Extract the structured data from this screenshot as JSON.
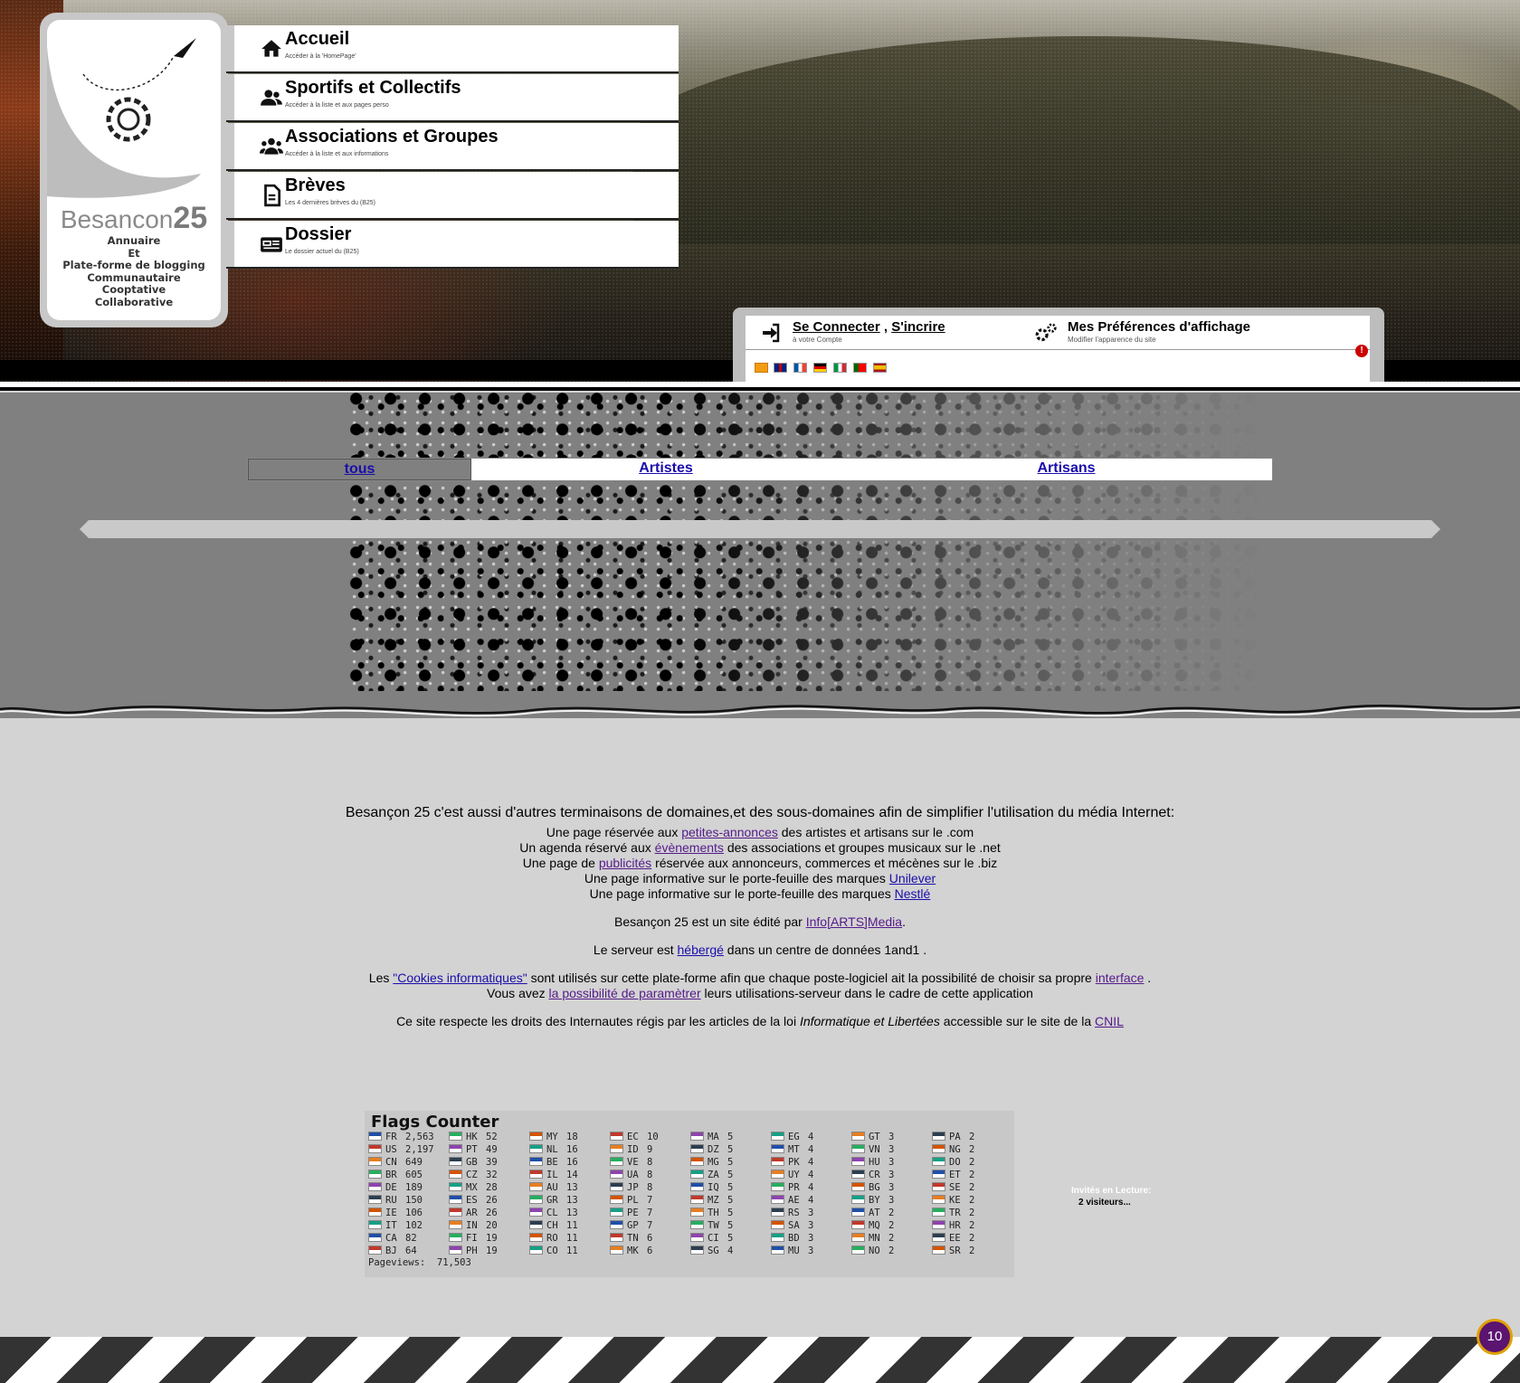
{
  "logo": {
    "brand_text": "Besancon",
    "brand_number": "25",
    "tagline": [
      "Annuaire",
      "Et",
      "Plate-forme de blogging",
      "Communautaire",
      "Cooptative",
      "Collaborative"
    ]
  },
  "nav": [
    {
      "title": "Accueil",
      "subtitle": "Accéder à la 'HomePage'",
      "icon": "home-icon"
    },
    {
      "title": "Sportifs et Collectifs",
      "subtitle": "Accéder à la liste et aux pages perso",
      "icon": "users-icon"
    },
    {
      "title": "Associations et Groupes",
      "subtitle": "Accéder à la liste et aux informations",
      "icon": "group-icon"
    },
    {
      "title": "Brèves",
      "subtitle": "Les 4 dernières brèves du (B25)",
      "icon": "document-icon"
    },
    {
      "title": "Dossier",
      "subtitle": "Le dossier actuel du (B25)",
      "icon": "newspaper-icon"
    }
  ],
  "account": {
    "login_label": "Se Connecter",
    "separator": ",",
    "register_label": "S'incrire",
    "login_sub": "à votre Compte",
    "prefs_label": "Mes Préférences d'affichage",
    "prefs_sub": "Modifier l'apparence du site",
    "flags": [
      "rss",
      "gb",
      "fr",
      "de",
      "it",
      "pt",
      "es"
    ]
  },
  "tabs": [
    {
      "label": "tous",
      "active": true
    },
    {
      "label": "Artistes",
      "active": false
    },
    {
      "label": "Artisans",
      "active": false
    }
  ],
  "info": {
    "lead": "Besançon 25 c'est aussi d'autres terminaisons de domaines,et des sous-domaines afin de simplifier l'utilisation du média Internet:",
    "l1a": "Une page réservée aux ",
    "l1link": "petites-annonces",
    "l1b": " des artistes et artisans sur le .com",
    "l2a": "Un agenda réservé aux ",
    "l2link": "évènements",
    "l2b": " des associations et groupes musicaux sur le .net",
    "l3a": "Une page de ",
    "l3link": "publicités",
    "l3b": " réservée aux annonceurs, commerces et mécènes sur le .biz",
    "l4a": "Une page informative sur le porte-feuille des marques ",
    "l4link": "Unilever",
    "l5a": "Une page informative sur le porte-feuille des marques ",
    "l5link": "Nestlé",
    "ed_a": "Besançon 25 est un site édité par ",
    "ed_link": "Info[ARTS]Media",
    "ed_b": ".",
    "srv_a": "Le serveur est ",
    "srv_link": "hébergé",
    "srv_b": " dans un centre de données 1and1 .",
    "ck_a": "Les ",
    "ck_link": "\"Cookies informatiques\"",
    "ck_b": " sont utilisés sur cette plate-forme afin que chaque poste-logiciel ait la possibilité de choisir sa propre ",
    "ck_link2": "interface",
    "ck_c": " .",
    "ck2_a": "Vous avez ",
    "ck2_link": "la possibilité de paramètrer",
    "ck2_b": " leurs utilisations-serveur dans le cadre de cette application",
    "law_a": "Ce site respecte les droits des Internautes régis par les articles de la loi ",
    "law_em": "Informatique et Libertées",
    "law_b": " accessible sur le site de la ",
    "law_link": "CNIL"
  },
  "flags_counter": {
    "title": "Flags Counter",
    "pageviews_label": "Pageviews:",
    "pageviews": "71,503",
    "columns": [
      [
        [
          "FR",
          "2,563"
        ],
        [
          "US",
          "2,197"
        ],
        [
          "CN",
          "649"
        ],
        [
          "BR",
          "605"
        ],
        [
          "DE",
          "189"
        ],
        [
          "RU",
          "150"
        ],
        [
          "IE",
          "106"
        ],
        [
          "IT",
          "102"
        ],
        [
          "CA",
          "82"
        ],
        [
          "BJ",
          "64"
        ]
      ],
      [
        [
          "HK",
          "52"
        ],
        [
          "PT",
          "49"
        ],
        [
          "GB",
          "39"
        ],
        [
          "CZ",
          "32"
        ],
        [
          "MX",
          "28"
        ],
        [
          "ES",
          "26"
        ],
        [
          "AR",
          "26"
        ],
        [
          "IN",
          "20"
        ],
        [
          "FI",
          "19"
        ],
        [
          "PH",
          "19"
        ]
      ],
      [
        [
          "MY",
          "18"
        ],
        [
          "NL",
          "16"
        ],
        [
          "BE",
          "16"
        ],
        [
          "IL",
          "14"
        ],
        [
          "AU",
          "13"
        ],
        [
          "GR",
          "13"
        ],
        [
          "CL",
          "13"
        ],
        [
          "CH",
          "11"
        ],
        [
          "RO",
          "11"
        ],
        [
          "CO",
          "11"
        ]
      ],
      [
        [
          "EC",
          "10"
        ],
        [
          "ID",
          "9"
        ],
        [
          "VE",
          "8"
        ],
        [
          "UA",
          "8"
        ],
        [
          "JP",
          "8"
        ],
        [
          "PL",
          "7"
        ],
        [
          "PE",
          "7"
        ],
        [
          "GP",
          "7"
        ],
        [
          "TN",
          "6"
        ],
        [
          "MK",
          "6"
        ]
      ],
      [
        [
          "MA",
          "5"
        ],
        [
          "DZ",
          "5"
        ],
        [
          "MG",
          "5"
        ],
        [
          "ZA",
          "5"
        ],
        [
          "IQ",
          "5"
        ],
        [
          "MZ",
          "5"
        ],
        [
          "TH",
          "5"
        ],
        [
          "TW",
          "5"
        ],
        [
          "CI",
          "5"
        ],
        [
          "SG",
          "4"
        ]
      ],
      [
        [
          "EG",
          "4"
        ],
        [
          "MT",
          "4"
        ],
        [
          "PK",
          "4"
        ],
        [
          "UY",
          "4"
        ],
        [
          "PR",
          "4"
        ],
        [
          "AE",
          "4"
        ],
        [
          "RS",
          "3"
        ],
        [
          "SA",
          "3"
        ],
        [
          "BD",
          "3"
        ],
        [
          "MU",
          "3"
        ]
      ],
      [
        [
          "GT",
          "3"
        ],
        [
          "VN",
          "3"
        ],
        [
          "HU",
          "3"
        ],
        [
          "CR",
          "3"
        ],
        [
          "BG",
          "3"
        ],
        [
          "BY",
          "3"
        ],
        [
          "AT",
          "2"
        ],
        [
          "MQ",
          "2"
        ],
        [
          "MN",
          "2"
        ],
        [
          "NO",
          "2"
        ]
      ],
      [
        [
          "PA",
          "2"
        ],
        [
          "NG",
          "2"
        ],
        [
          "DO",
          "2"
        ],
        [
          "ET",
          "2"
        ],
        [
          "SE",
          "2"
        ],
        [
          "KE",
          "2"
        ],
        [
          "TR",
          "2"
        ],
        [
          "HR",
          "2"
        ],
        [
          "EE",
          "2"
        ],
        [
          "SR",
          "2"
        ]
      ]
    ]
  },
  "guests": {
    "label": "Invités en Lecture:",
    "count": "2 visiteurs..."
  },
  "badge": "10",
  "colors": {
    "link": "#1a0dab",
    "visited": "#551a8b",
    "badge_bg": "#5b1470",
    "badge_ring": "#e0a000"
  }
}
